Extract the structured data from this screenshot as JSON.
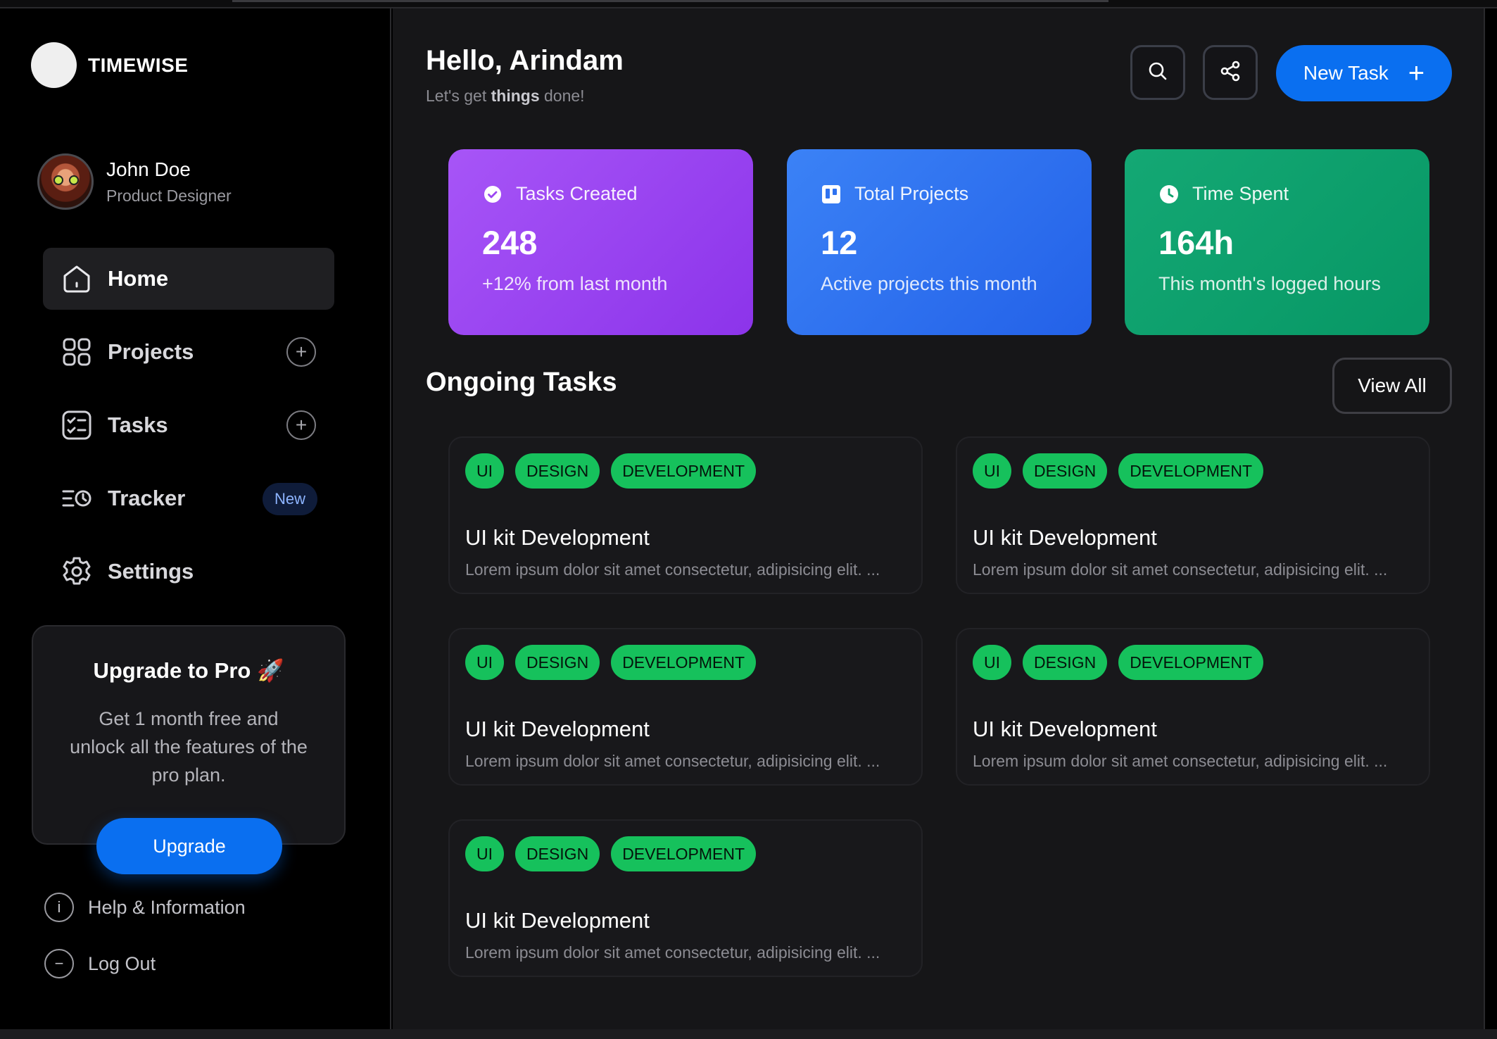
{
  "brand": {
    "name": "TIMEWISE"
  },
  "profile": {
    "name": "John Doe",
    "role": "Product Designer"
  },
  "nav": {
    "items": [
      {
        "label": "Home",
        "icon": "home-icon",
        "active": true
      },
      {
        "label": "Projects",
        "icon": "grid-icon",
        "action": "+"
      },
      {
        "label": "Tasks",
        "icon": "checklist-icon",
        "action": "+"
      },
      {
        "label": "Tracker",
        "icon": "tracker-icon",
        "badge": "New"
      },
      {
        "label": "Settings",
        "icon": "gear-icon"
      }
    ]
  },
  "promo": {
    "title": "Upgrade to Pro 🚀",
    "text": "Get 1 month free and unlock all the features of the pro plan.",
    "button": "Upgrade"
  },
  "footer": {
    "help": "Help & Information",
    "logout": "Log Out"
  },
  "header": {
    "greeting": "Hello, Arindam",
    "sub_prefix": "Let's get ",
    "sub_bold": "things",
    "sub_suffix": " done!",
    "new_task": "New Task"
  },
  "stats": [
    {
      "title": "Tasks Created",
      "value": "248",
      "note": "+12% from last month",
      "icon": "check-circle-icon",
      "color": "#9b45f2"
    },
    {
      "title": "Total Projects",
      "value": "12",
      "note": "Active projects this month",
      "icon": "board-icon",
      "color": "#2f72f0"
    },
    {
      "title": "Time Spent",
      "value": "164h",
      "note": "This month's logged hours",
      "icon": "clock-icon",
      "color": "#0ea06d"
    }
  ],
  "ongoing": {
    "title": "Ongoing Tasks",
    "view_all": "View All",
    "tasks": [
      {
        "tags": [
          "UI",
          "DESIGN",
          "DEVELOPMENT"
        ],
        "title": "UI kit Development",
        "desc": "Lorem ipsum dolor sit amet consectetur, adipisicing elit. ..."
      },
      {
        "tags": [
          "UI",
          "DESIGN",
          "DEVELOPMENT"
        ],
        "title": "UI kit Development",
        "desc": "Lorem ipsum dolor sit amet consectetur, adipisicing elit. ..."
      },
      {
        "tags": [
          "UI",
          "DESIGN",
          "DEVELOPMENT"
        ],
        "title": "UI kit Development",
        "desc": "Lorem ipsum dolor sit amet consectetur, adipisicing elit. ..."
      },
      {
        "tags": [
          "UI",
          "DESIGN",
          "DEVELOPMENT"
        ],
        "title": "UI kit Development",
        "desc": "Lorem ipsum dolor sit amet consectetur, adipisicing elit. ..."
      },
      {
        "tags": [
          "UI",
          "DESIGN",
          "DEVELOPMENT"
        ],
        "title": "UI kit Development",
        "desc": "Lorem ipsum dolor sit amet consectetur, adipisicing elit. ..."
      }
    ]
  },
  "colors": {
    "accent": "#0a6ff0",
    "tag": "#16c15c",
    "panel": "#161618"
  }
}
